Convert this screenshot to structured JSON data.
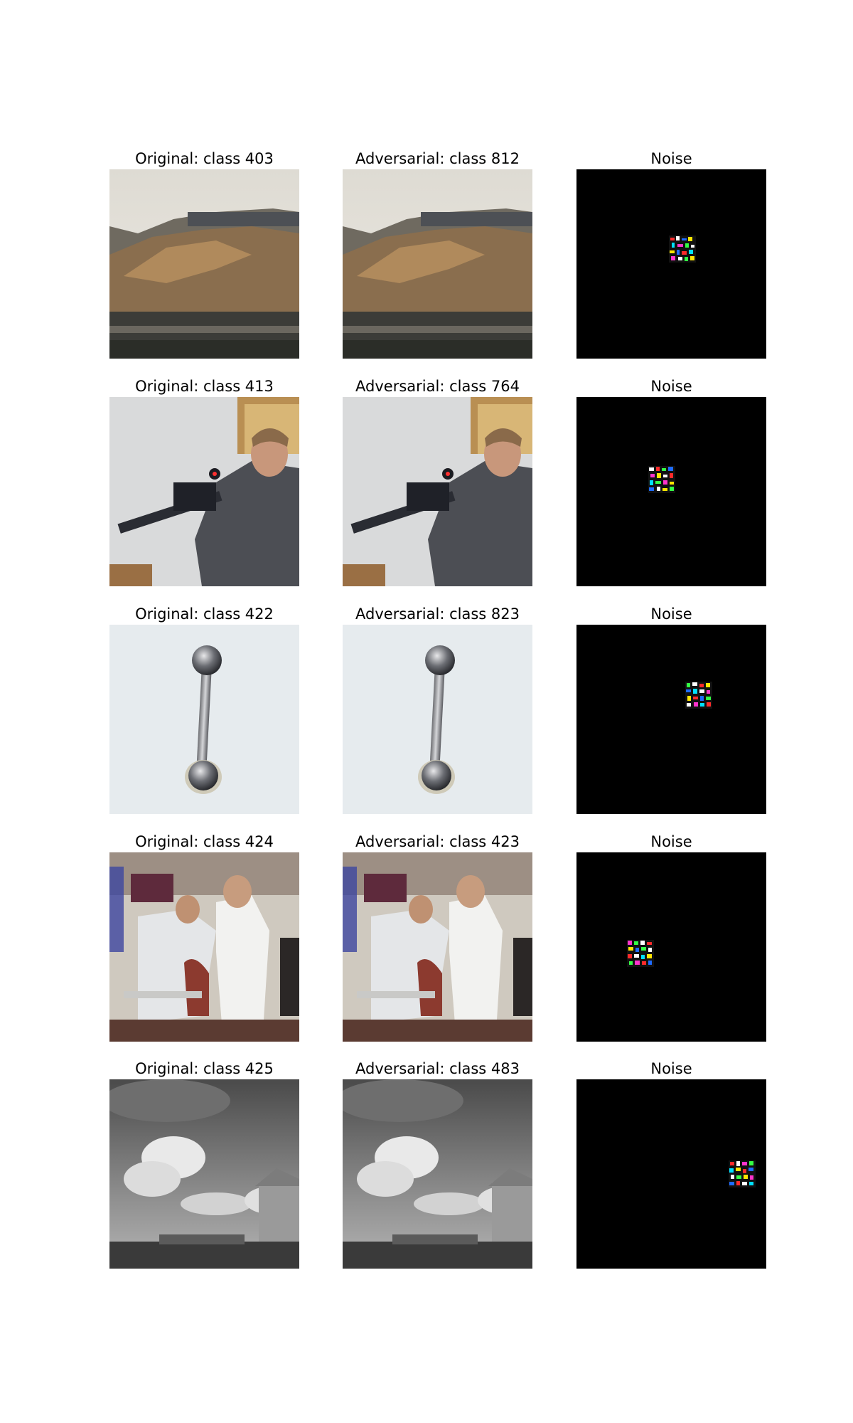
{
  "figure": {
    "rows": [
      {
        "original_title": "Original: class 403",
        "adversarial_title": "Adversarial: class 812",
        "noise_title": "Noise",
        "scene": "aircraft-carrier"
      },
      {
        "original_title": "Original: class 413",
        "adversarial_title": "Adversarial: class 764",
        "noise_title": "Noise",
        "scene": "man-with-rifle"
      },
      {
        "original_title": "Original: class 422",
        "adversarial_title": "Adversarial: class 823",
        "noise_title": "Noise",
        "scene": "barbell"
      },
      {
        "original_title": "Original: class 424",
        "adversarial_title": "Adversarial: class 423",
        "noise_title": "Noise",
        "scene": "barbershop"
      },
      {
        "original_title": "Original: class 425",
        "adversarial_title": "Adversarial: class 483",
        "noise_title": "Noise",
        "scene": "clouds-and-barn"
      }
    ],
    "colors": {
      "noise_background": "#000000",
      "page_background": "#ffffff"
    }
  }
}
